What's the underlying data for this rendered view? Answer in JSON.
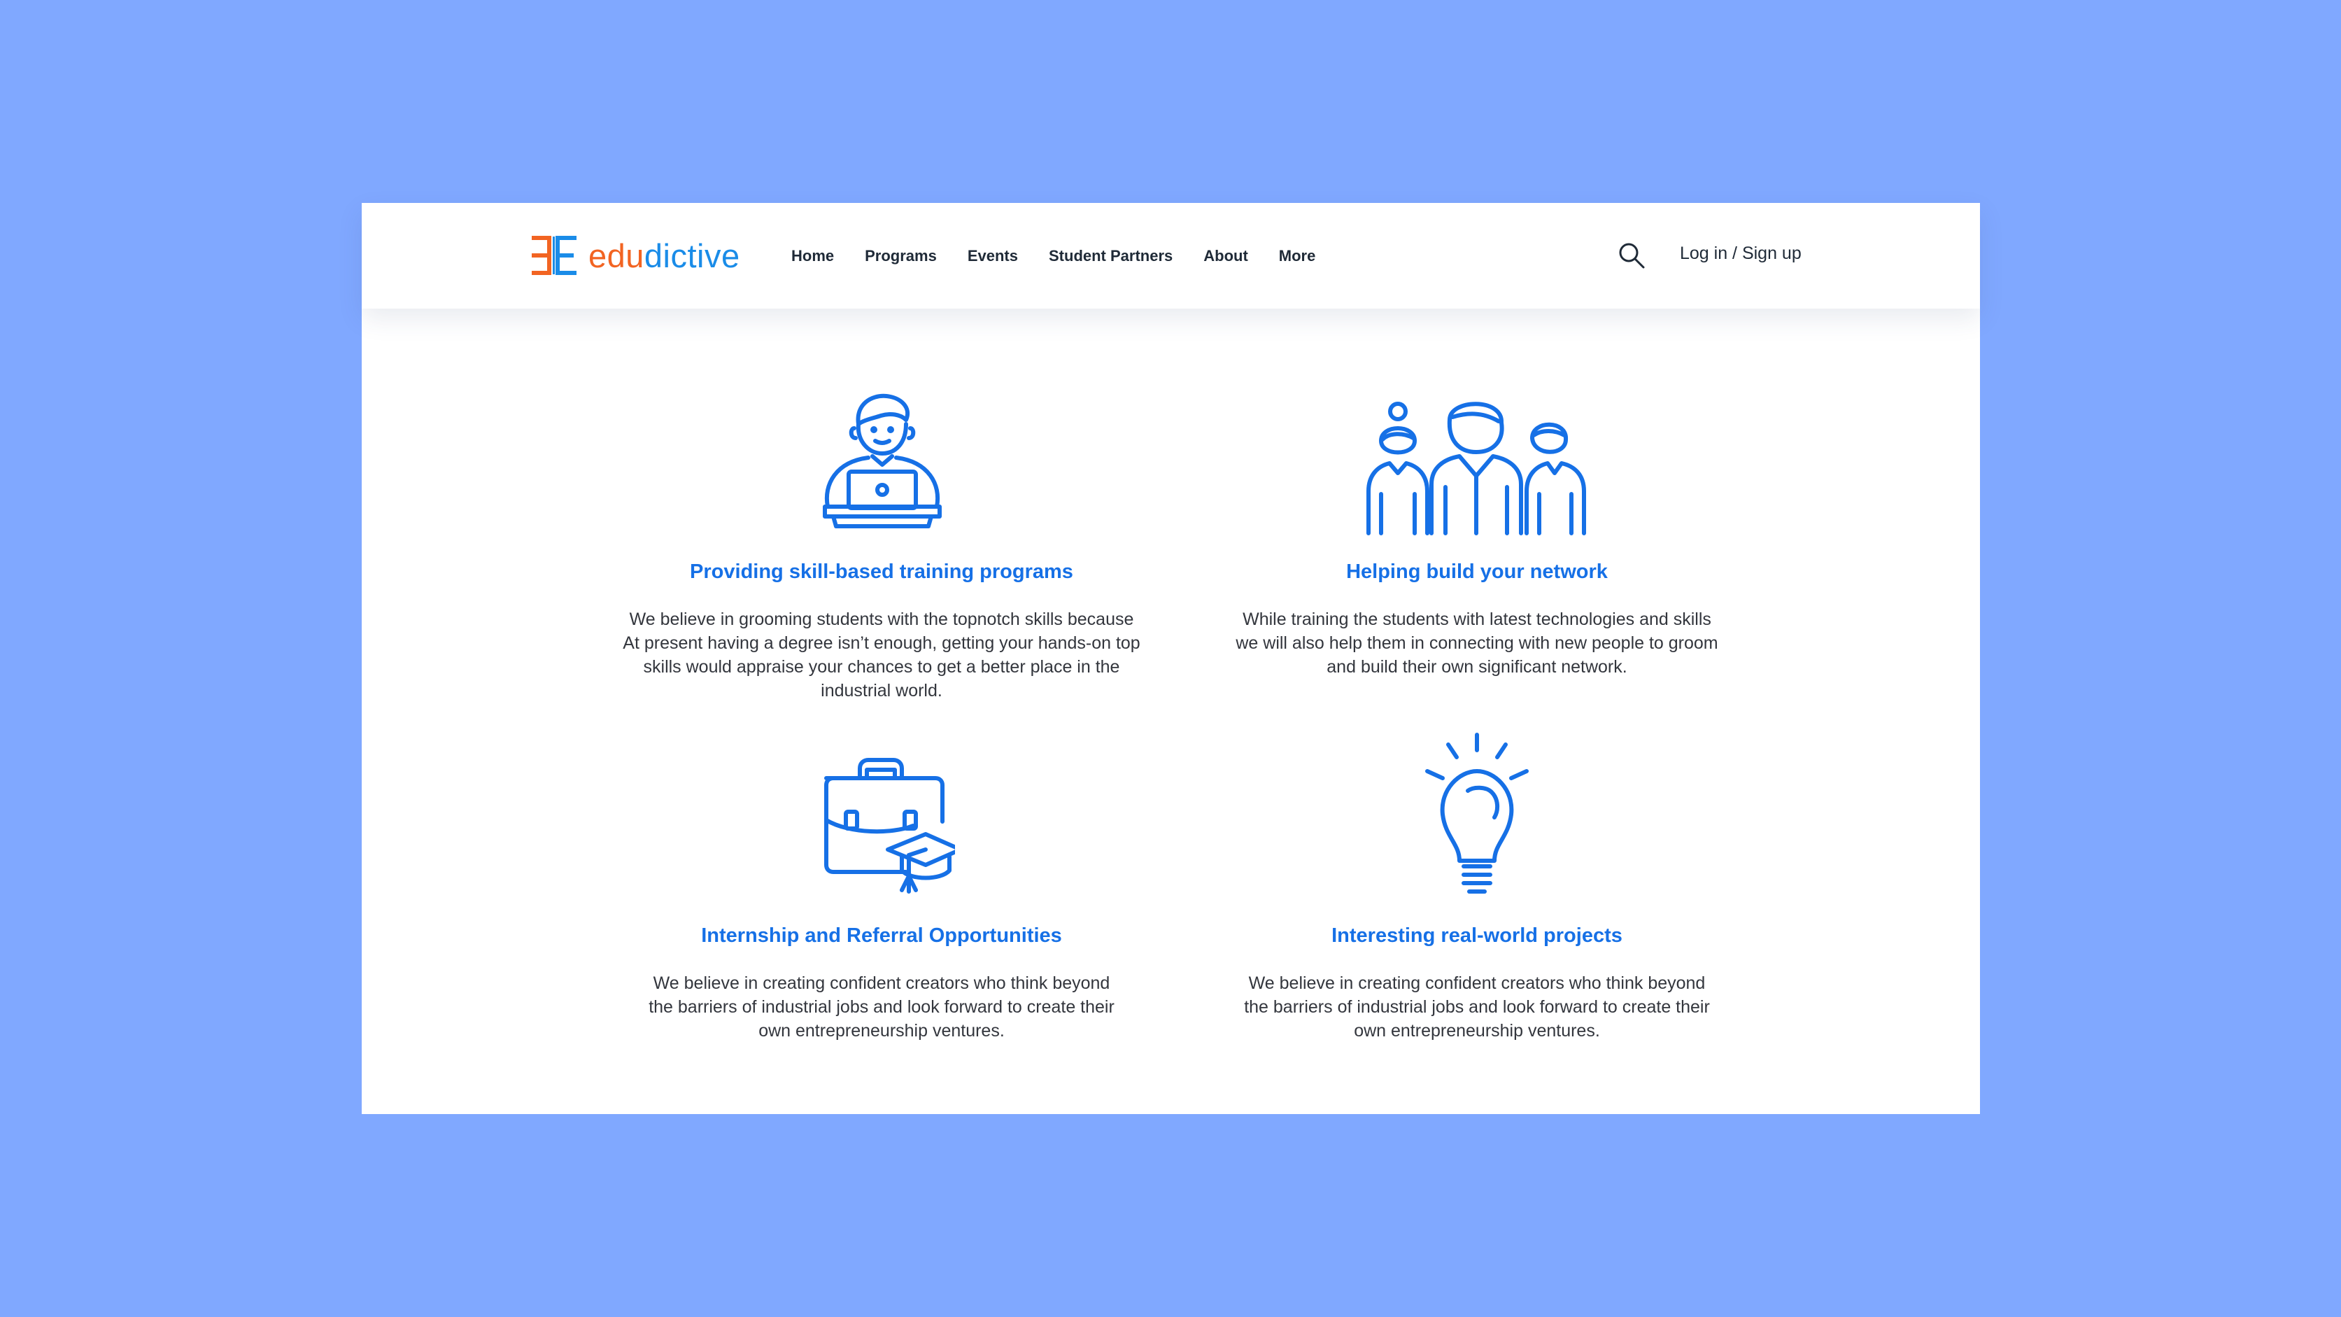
{
  "brand": {
    "name_part1": "edu",
    "name_part2": "dictive",
    "colors": {
      "orange": "#f26422",
      "blue": "#1a8ce8"
    }
  },
  "nav": {
    "links": [
      "Home",
      "Programs",
      "Events",
      "Student Partners",
      "About",
      "More"
    ],
    "search_icon": "search-icon",
    "login_label": "Log in / Sign up"
  },
  "accent_color": "#1670e6",
  "features": [
    {
      "icon": "student-laptop-icon",
      "title": "Providing skill-based training programs",
      "description": "We believe in grooming students with the topnotch skills because At present having a degree isn’t enough, getting your hands-on top skills would appraise your chances to get a better place in the industrial world."
    },
    {
      "icon": "people-network-icon",
      "title": "Helping build your network",
      "description": "While training the students with latest technologies and skills we will also help them in connecting with new people to groom and build their own significant network."
    },
    {
      "icon": "briefcase-graduation-icon",
      "title": "Internship and Referral Opportunities",
      "description": "We believe in creating confident creators who think beyond the barriers of industrial jobs and look forward to create their own entrepreneurship ventures."
    },
    {
      "icon": "lightbulb-icon",
      "title": "Interesting real-world projects",
      "description": "We believe in creating confident creators who think beyond the barriers of industrial jobs and look forward to create their own entrepreneurship ventures."
    }
  ]
}
